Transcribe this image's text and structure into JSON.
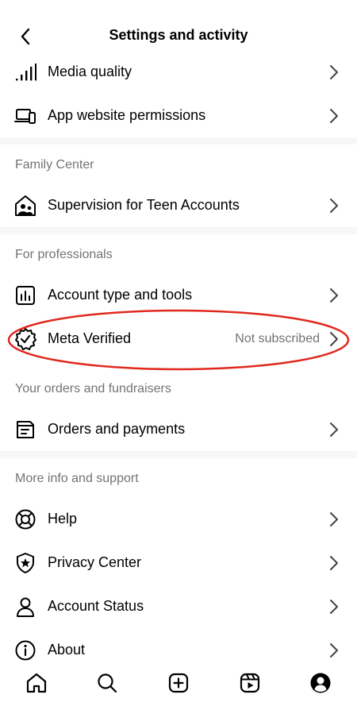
{
  "header": {
    "title": "Settings and activity",
    "back_icon": "chevron-left-icon"
  },
  "rows": {
    "media_quality": {
      "label": "Media quality",
      "icon": "signal-bars-icon"
    },
    "app_permissions": {
      "label": "App website permissions",
      "icon": "devices-icon"
    },
    "supervision": {
      "label": "Supervision for Teen Accounts",
      "icon": "family-house-icon"
    },
    "account_type": {
      "label": "Account type and tools",
      "icon": "bar-chart-icon"
    },
    "meta_verified": {
      "label": "Meta Verified",
      "status": "Not subscribed",
      "icon": "verified-badge-icon"
    },
    "orders": {
      "label": "Orders and payments",
      "icon": "receipt-icon"
    },
    "help": {
      "label": "Help",
      "icon": "lifebuoy-icon"
    },
    "privacy": {
      "label": "Privacy Center",
      "icon": "shield-star-icon"
    },
    "account_status": {
      "label": "Account Status",
      "icon": "person-icon"
    },
    "about": {
      "label": "About",
      "icon": "info-icon"
    }
  },
  "sections": {
    "family": "Family Center",
    "professionals": "For professionals",
    "orders": "Your orders and fundraisers",
    "support": "More info and support"
  },
  "bottom_nav": [
    "home-icon",
    "search-icon",
    "create-icon",
    "reels-icon",
    "profile-icon"
  ],
  "colors": {
    "secondary_text": "#737373",
    "highlight": "#e0291f",
    "divider": "#f7f7f7"
  }
}
